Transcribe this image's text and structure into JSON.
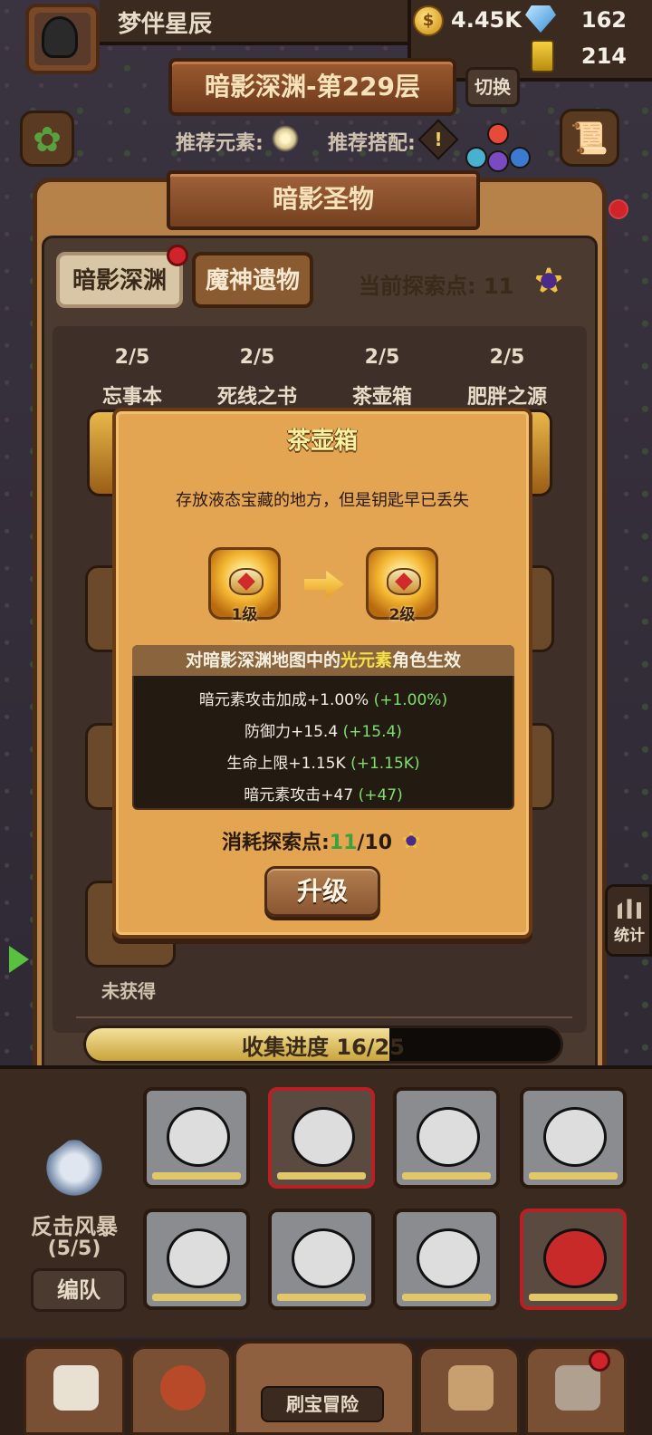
{
  "player": {
    "name": "梦伴星辰"
  },
  "resources": {
    "coins": "4.45K",
    "gems": "162",
    "stamina": "214"
  },
  "stage": {
    "title": "暗影深渊-第229层",
    "switch_label": "切换"
  },
  "recommend": {
    "element_label": "推荐元素:",
    "combo_label": "推荐搭配:"
  },
  "panel": {
    "title": "暗影圣物",
    "tabs": [
      {
        "label": "暗影深渊"
      },
      {
        "label": "魔神遗物"
      }
    ],
    "explore_label": "当前探索点: 11",
    "relics": [
      {
        "count": "2/5",
        "name": "忘事本"
      },
      {
        "count": "2/5",
        "name": "死线之书"
      },
      {
        "count": "2/5",
        "name": "茶壶箱"
      },
      {
        "count": "2/5",
        "name": "肥胖之源"
      }
    ],
    "unobtained_label": "未获得",
    "progress": {
      "label": "收集进度 16/25",
      "fraction": 0.64
    }
  },
  "popup": {
    "title": "茶壶箱",
    "description": "存放液态宝藏的地方，但是钥匙早已丢失",
    "from_level": "1级",
    "to_level": "2级",
    "effect_head_prefix": "对暗影深渊地图中的",
    "effect_head_highlight": "光元素",
    "effect_head_suffix": "角色生效",
    "effects": [
      {
        "text": "暗元素攻击加成+1.00%",
        "delta": "(+1.00%)"
      },
      {
        "text": "防御力+15.4",
        "delta": "(+15.4)"
      },
      {
        "text": "生命上限+1.15K",
        "delta": "(+1.15K)"
      },
      {
        "text": "暗元素攻击+47",
        "delta": "(+47)"
      }
    ],
    "cost_label": "消耗探索点:",
    "cost_have": "11",
    "cost_need": "/10",
    "upgrade_label": "升级"
  },
  "team": {
    "formation_name": "反击风暴",
    "formation_count": "(5/5)",
    "edit_label": "编队"
  },
  "side": {
    "stats_label": "统计"
  },
  "nav": {
    "main_label": "刷宝冒险"
  }
}
